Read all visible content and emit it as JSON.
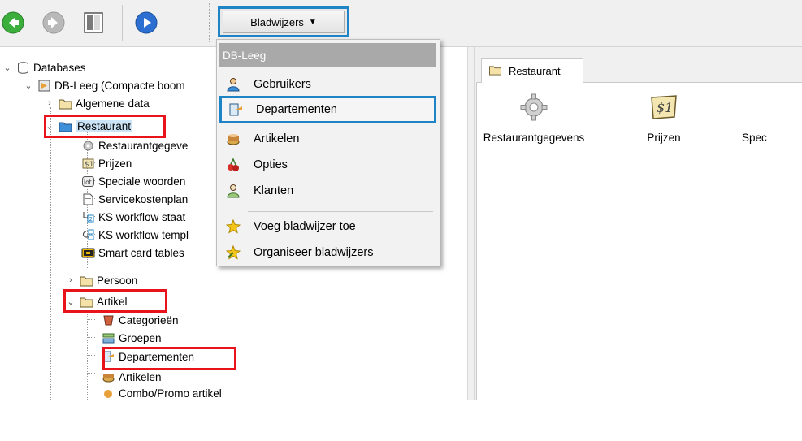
{
  "toolbar": {
    "back_icon": "back-arrow-icon",
    "forward_icon": "forward-arrow-icon",
    "panel_icon": "panel-toggle-icon",
    "play_icon": "play-icon",
    "bookmarks_label": "Bladwijzers"
  },
  "menu": {
    "header": "DB-Leeg",
    "items": [
      {
        "label": "Gebruikers",
        "icon": "users-icon"
      },
      {
        "label": "Departementen",
        "icon": "departments-icon",
        "highlighted": true
      },
      {
        "label": "Artikelen",
        "icon": "articles-icon"
      },
      {
        "label": "Opties",
        "icon": "options-icon"
      },
      {
        "label": "Klanten",
        "icon": "customers-icon"
      },
      {
        "label": "Voeg bladwijzer toe",
        "icon": "star-icon"
      },
      {
        "label": "Organiseer bladwijzers",
        "icon": "star-organize-icon"
      }
    ]
  },
  "tree": {
    "nodes": [
      {
        "label": "Databases",
        "icon": "database-icon",
        "expanded": true
      },
      {
        "label": "DB-Leeg (Compacte boom",
        "icon": "db-icon",
        "expanded": true
      },
      {
        "label": "Algemene data",
        "icon": "folder-icon",
        "expanded": false
      },
      {
        "label": "Restaurant",
        "icon": "folder-open-icon",
        "expanded": true,
        "selected": true
      },
      {
        "label": "Restaurantgegeve",
        "icon": "gear-icon"
      },
      {
        "label": "Prijzen",
        "icon": "price-icon"
      },
      {
        "label": "Speciale woorden",
        "icon": "special-words-icon"
      },
      {
        "label": "Servicekostenplan",
        "icon": "document-icon"
      },
      {
        "label": "KS workflow staat",
        "icon": "workflow-icon"
      },
      {
        "label": "KS workflow templ",
        "icon": "workflow-template-icon"
      },
      {
        "label": "Smart card tables",
        "icon": "smartcard-icon"
      },
      {
        "label": "Persoon",
        "icon": "folder-icon",
        "expanded": false
      },
      {
        "label": "Artikel",
        "icon": "folder-open-icon",
        "expanded": true
      },
      {
        "label": "Categorieën",
        "icon": "categories-icon"
      },
      {
        "label": "Groepen",
        "icon": "groups-icon"
      },
      {
        "label": "Departementen",
        "icon": "departments-icon"
      },
      {
        "label": "Artikelen",
        "icon": "articles-icon"
      },
      {
        "label": "Combo/Promo artikel",
        "icon": "combo-icon"
      }
    ]
  },
  "right_panel": {
    "tab_label": "Restaurant",
    "tiles": [
      {
        "label": "Restaurantgegevens",
        "icon": "gear-icon"
      },
      {
        "label": "Prijzen",
        "icon": "price-icon"
      },
      {
        "label": "Spec",
        "icon": "special-words-icon"
      }
    ]
  },
  "colors": {
    "highlight_blue": "#1e84c6",
    "annotation_red": "#e8131b",
    "selection": "#cce4f7"
  }
}
